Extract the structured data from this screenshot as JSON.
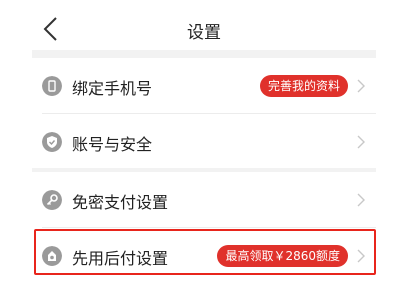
{
  "header": {
    "title": "设置",
    "back_icon": "chevron-left-icon"
  },
  "sections": [
    {
      "items": [
        {
          "label": "绑定手机号",
          "icon": "phone-icon",
          "badge": "完善我的资料"
        },
        {
          "label": "账号与安全",
          "icon": "shield-check-icon",
          "badge": ""
        }
      ]
    },
    {
      "items": [
        {
          "label": "免密支付设置",
          "icon": "key-icon",
          "badge": ""
        },
        {
          "label": "先用后付设置",
          "icon": "pay-later-icon",
          "badge": "最高领取￥2860额度"
        }
      ]
    }
  ],
  "colors": {
    "accent": "#e0312b",
    "highlight_border": "#e8251c",
    "section_gap": "#f2f2f2"
  }
}
